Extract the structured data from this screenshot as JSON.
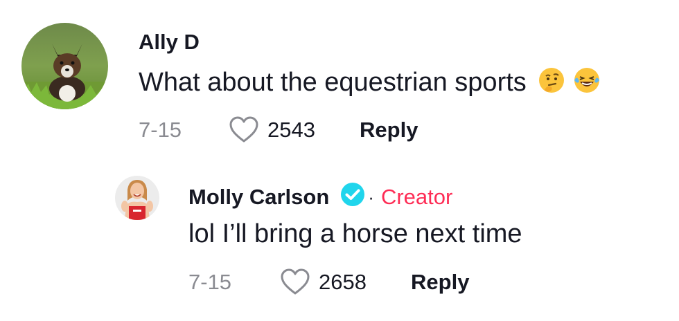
{
  "comments": [
    {
      "username": "Ally D",
      "text": "What about the equestrian sports",
      "emojis": [
        "thinking-face-emoji",
        "laughing-tears-emoji"
      ],
      "date": "7-15",
      "likes": "2543",
      "reply_label": "Reply"
    }
  ],
  "reply": {
    "username": "Molly Carlson",
    "verified": true,
    "separator": "·",
    "creator_label": "Creator",
    "text": "lol I’ll bring a horse next time",
    "date": "7-15",
    "likes": "2658",
    "reply_label": "Reply"
  },
  "colors": {
    "creator": "#fe2c55",
    "verified_badge": "#20d5ec",
    "secondary_text": "#8a8b91",
    "primary_text": "#161823"
  },
  "icons": [
    "heart-outline-icon",
    "verified-badge-icon"
  ]
}
